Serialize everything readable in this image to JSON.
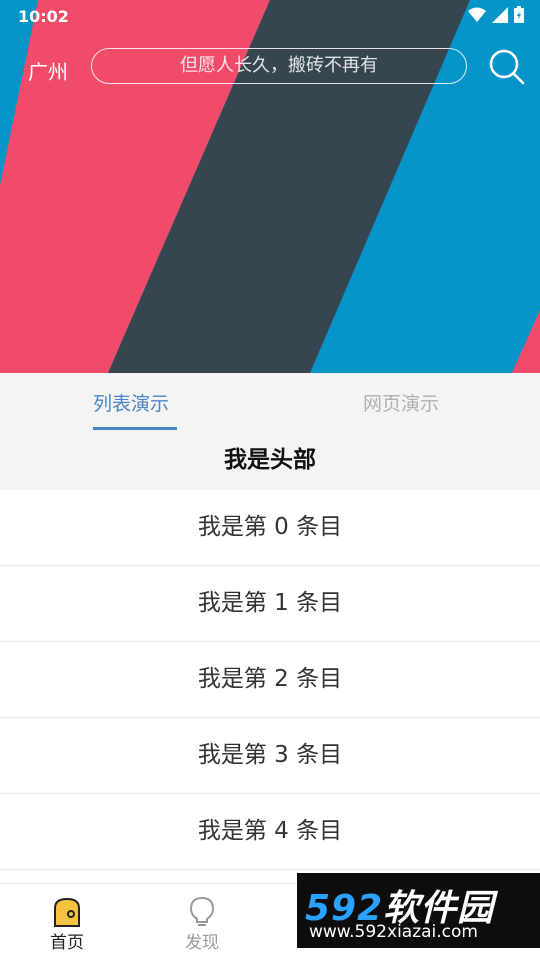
{
  "status_bar": {
    "time": "10:02"
  },
  "header": {
    "city": "广州",
    "search_placeholder": "但愿人长久，搬砖不再有"
  },
  "tabs": [
    {
      "label": "列表演示",
      "active": true
    },
    {
      "label": "网页演示",
      "active": false
    }
  ],
  "list_header": "我是头部",
  "list_items": [
    "我是第 0 条目",
    "我是第 1 条目",
    "我是第 2 条目",
    "我是第 3 条目",
    "我是第 4 条目"
  ],
  "bottom_nav": [
    {
      "label": "首页",
      "active": true
    },
    {
      "label": "发现",
      "active": false
    }
  ],
  "watermark": {
    "brand_number": "592",
    "brand_text": "软件园",
    "url": "www.592xiazai.com"
  },
  "colors": {
    "banner_blue": "#0795c9",
    "banner_red": "#f04c6a",
    "banner_dark": "#364651",
    "accent": "#4a85c8"
  }
}
